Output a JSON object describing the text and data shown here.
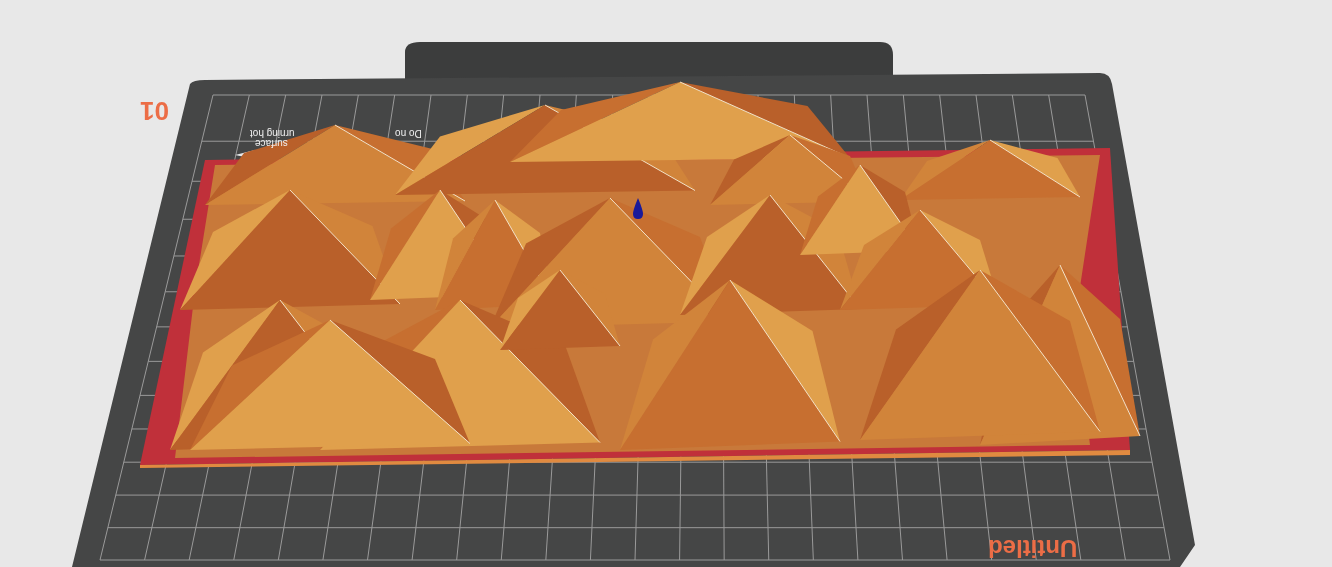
{
  "bed": {
    "labels": [
      {
        "kind": "number",
        "text": "01"
      },
      {
        "kind": "name",
        "text": "Untitled"
      }
    ],
    "warning": [
      "Do no",
      "urning hot",
      "surface"
    ]
  }
}
